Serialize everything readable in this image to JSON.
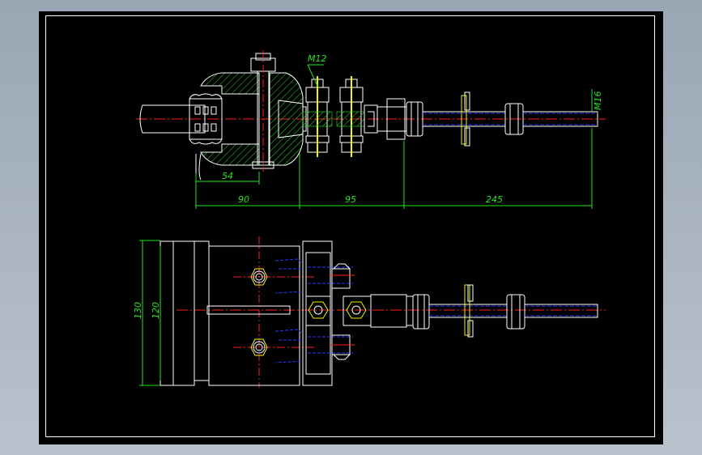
{
  "drawing": {
    "dimensions": {
      "inner_length": "54",
      "seg_1": "90",
      "seg_2": "95",
      "seg_3": "245",
      "outer_height": "130",
      "inner_height": "120"
    },
    "thread_labels": {
      "bolt": "M12",
      "rod": "M16"
    }
  },
  "colors": {
    "background": "#000000",
    "outline": "#ffffff",
    "dimension": "#22e61d",
    "centerline": "#ff2020",
    "hidden": "#2838ff",
    "bolt": "#f4f400",
    "hatch": "#22e61d"
  }
}
